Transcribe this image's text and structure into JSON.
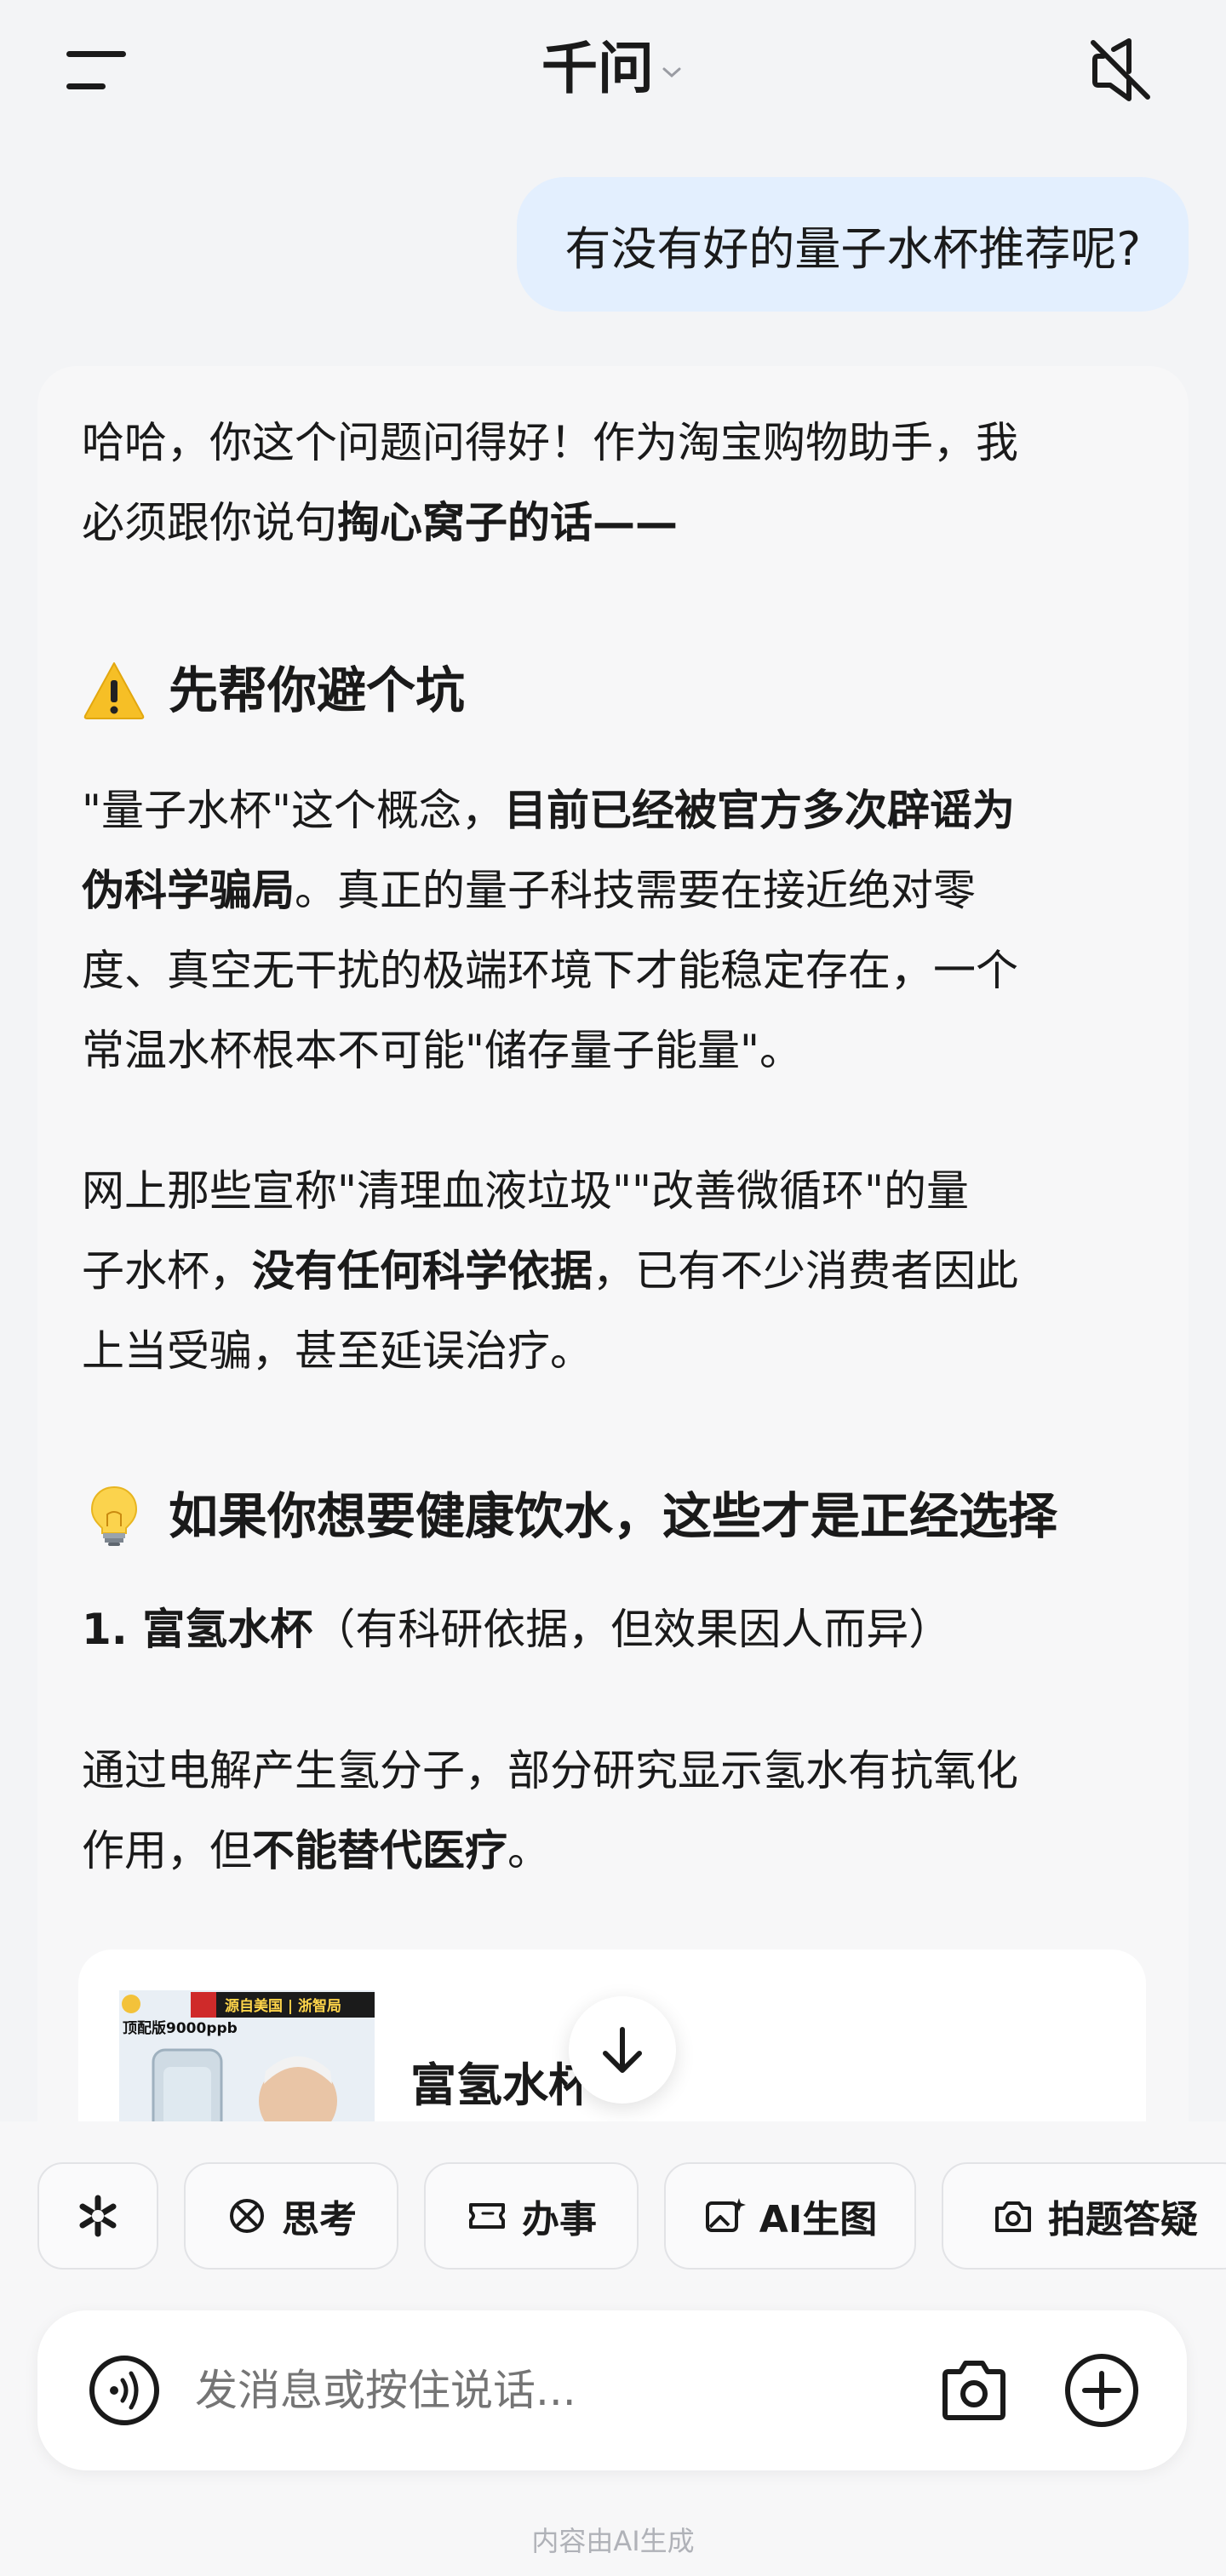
{
  "header": {
    "title": "千问",
    "menu_icon": "hamburger-menu-icon",
    "mute_icon": "speaker-muted-icon"
  },
  "user_message": "有没有好的量子水杯推荐呢?",
  "ai_message": {
    "intro_1": "哈哈，你这个问题问得好！作为淘宝购物助手，我",
    "intro_2a": "必须跟你说句",
    "intro_2b": "掏心窝子的话——",
    "section1_heading": "先帮你避个坑",
    "section1_icon": "warning-icon",
    "s1_p1_l1a": "\"量子水杯\"这个概念，",
    "s1_p1_l1b": "目前已经被官方多次辟谣为",
    "s1_p1_l2a": "伪科学骗局",
    "s1_p1_l2b": "。真正的量子科技需要在接近绝对零",
    "s1_p1_l3": "度、真空无干扰的极端环境下才能稳定存在，一个",
    "s1_p1_l4": "常温水杯根本不可能\"储存量子能量\"。",
    "s1_p2_l1": "网上那些宣称\"清理血液垃圾\"\"改善微循环\"的量",
    "s1_p2_l2a": "子水杯，",
    "s1_p2_l2b": "没有任何科学依据",
    "s1_p2_l2c": "，已有不少消费者因此",
    "s1_p2_l3": "上当受骗，甚至延误治疗。",
    "section2_heading": "如果你想要健康饮水，这些才是正经选择",
    "section2_icon": "lightbulb-icon",
    "item1_title": "1. 富氢水杯",
    "item1_note": "（有科研依据，但效果因人而异）",
    "item1_l1": "通过电解产生氢分子，部分研究显示氢水有抗氧化",
    "item1_l2a": "作用，但",
    "item1_l2b": "不能替代医疗",
    "item1_l2c": "。"
  },
  "product_card": {
    "name": "富氢水杯",
    "image_badge_top": "源自美国 | 浙智局",
    "image_badge_left": "顶配版9000ppb"
  },
  "scroll_down_icon": "arrow-down-icon",
  "chips": [
    {
      "label": "",
      "icon": "sparkle-icon"
    },
    {
      "label": "思考",
      "icon": "think-icon"
    },
    {
      "label": "办事",
      "icon": "ticket-icon"
    },
    {
      "label": "AI生图",
      "icon": "image-ai-icon"
    },
    {
      "label": "拍题答疑",
      "icon": "camera-question-icon"
    }
  ],
  "input": {
    "placeholder": "发消息或按住说话..."
  },
  "footer_note": "内容由AI生成"
}
